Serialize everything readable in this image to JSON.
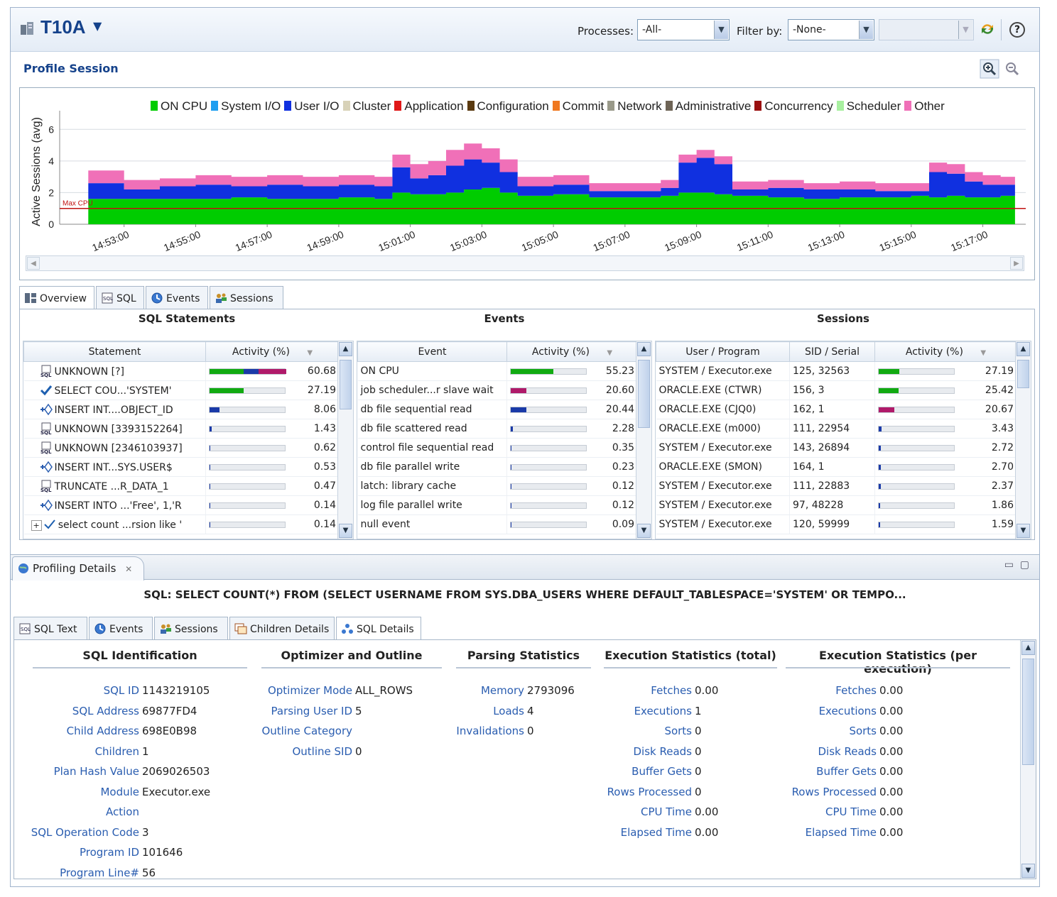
{
  "header": {
    "db_name": "T10A",
    "processes_label": "Processes:",
    "processes_value": "-All-",
    "filter_label": "Filter by:",
    "filter_value": "-None-",
    "help_label": "?"
  },
  "profile": {
    "title": "Profile Session"
  },
  "legend": [
    {
      "label": "ON CPU",
      "color": "#00cc00"
    },
    {
      "label": "System I/O",
      "color": "#1e9ef0"
    },
    {
      "label": "User I/O",
      "color": "#1030e0"
    },
    {
      "label": "Cluster",
      "color": "#d8d2b8"
    },
    {
      "label": "Application",
      "color": "#e01818"
    },
    {
      "label": "Configuration",
      "color": "#5a3a10"
    },
    {
      "label": "Commit",
      "color": "#f07820"
    },
    {
      "label": "Network",
      "color": "#9a9a8a"
    },
    {
      "label": "Administrative",
      "color": "#6e6456"
    },
    {
      "label": "Concurrency",
      "color": "#9a1010"
    },
    {
      "label": "Scheduler",
      "color": "#a8f0a0"
    },
    {
      "label": "Other",
      "color": "#f070b8"
    }
  ],
  "chart_data": {
    "type": "area",
    "ylabel": "Active Sessions (avg)",
    "yticks": [
      "0",
      "2",
      "4",
      "6"
    ],
    "ylim": [
      0,
      7
    ],
    "max_cpu_label": "Max CPU",
    "max_cpu_value": 1,
    "xticks": [
      "14:53:00",
      "14:55:00",
      "14:57:00",
      "14:59:00",
      "15:01:00",
      "15:03:00",
      "15:05:00",
      "15:07:00",
      "15:09:00",
      "15:11:00",
      "15:13:00",
      "15:15:00",
      "15:17:00"
    ],
    "x": [
      "14:52:00",
      "14:53:00",
      "14:54:00",
      "14:55:00",
      "14:56:00",
      "14:57:00",
      "14:58:00",
      "14:59:00",
      "15:00:00",
      "15:00:30",
      "15:01:00",
      "15:01:30",
      "15:02:00",
      "15:02:30",
      "15:03:00",
      "15:03:30",
      "15:04:00",
      "15:05:00",
      "15:06:00",
      "15:07:00",
      "15:08:00",
      "15:08:30",
      "15:09:00",
      "15:09:30",
      "15:10:00",
      "15:11:00",
      "15:12:00",
      "15:13:00",
      "15:14:00",
      "15:15:00",
      "15:15:30",
      "15:16:00",
      "15:16:30",
      "15:17:00",
      "15:17:30"
    ],
    "series": [
      {
        "name": "ON CPU",
        "color": "#00cc00",
        "values": [
          1.6,
          1.6,
          1.6,
          1.6,
          1.7,
          1.6,
          1.6,
          1.7,
          1.6,
          2.0,
          1.9,
          1.9,
          2.0,
          2.2,
          2.3,
          2.0,
          1.8,
          1.9,
          1.7,
          1.7,
          1.8,
          2.0,
          2.0,
          1.9,
          1.8,
          1.7,
          1.6,
          1.7,
          1.7,
          1.8,
          1.7,
          1.8,
          1.7,
          1.7,
          1.8
        ]
      },
      {
        "name": "User I/O",
        "color": "#1030e0",
        "values": [
          1.0,
          0.6,
          0.8,
          0.9,
          0.7,
          0.9,
          0.8,
          0.8,
          0.8,
          1.6,
          1.0,
          1.2,
          1.7,
          1.9,
          1.6,
          1.3,
          0.6,
          0.6,
          0.4,
          0.4,
          0.5,
          1.9,
          2.2,
          1.9,
          0.4,
          0.6,
          0.6,
          0.5,
          0.4,
          0.3,
          1.6,
          1.4,
          1.0,
          0.8,
          0.7
        ]
      },
      {
        "name": "Other",
        "color": "#f070b8",
        "values": [
          0.8,
          0.6,
          0.5,
          0.6,
          0.6,
          0.6,
          0.6,
          0.6,
          0.6,
          0.8,
          0.9,
          0.9,
          1.0,
          1.0,
          0.9,
          0.8,
          0.6,
          0.6,
          0.5,
          0.5,
          0.5,
          0.5,
          0.5,
          0.5,
          0.5,
          0.5,
          0.4,
          0.5,
          0.5,
          0.5,
          0.6,
          0.6,
          0.6,
          0.6,
          0.5
        ]
      }
    ]
  },
  "overview_tabs": [
    "Overview",
    "SQL",
    "Events",
    "Sessions"
  ],
  "sql_statements": {
    "title": "SQL Statements",
    "columns": [
      "Statement",
      "Activity (%)"
    ],
    "rows": [
      {
        "label": "UNKNOWN [?]",
        "value": "60.68",
        "pct": 60.68,
        "bars": [
          {
            "c": "#11aa11",
            "w": 0.44
          },
          {
            "c": "#1a3aa8",
            "w": 0.2
          },
          {
            "c": "#b01a6a",
            "w": 0.36
          }
        ]
      },
      {
        "label": "SELECT COU...'SYSTEM'",
        "value": "27.19",
        "pct": 27.19,
        "bars": [
          {
            "c": "#11aa11",
            "w": 1
          }
        ]
      },
      {
        "label": "INSERT INT....OBJECT_ID",
        "value": "8.06",
        "pct": 8.06,
        "bars": [
          {
            "c": "#1a3aa8",
            "w": 1
          }
        ]
      },
      {
        "label": "UNKNOWN [3393152264]",
        "value": "1.43",
        "pct": 1.43,
        "bars": [
          {
            "c": "#1a3aa8",
            "w": 1
          }
        ]
      },
      {
        "label": "UNKNOWN [2346103937]",
        "value": "0.62",
        "pct": 0.62,
        "bars": []
      },
      {
        "label": "INSERT INT...SYS.USER$",
        "value": "0.53",
        "pct": 0.53,
        "bars": []
      },
      {
        "label": "TRUNCATE ...R_DATA_1",
        "value": "0.47",
        "pct": 0.47,
        "bars": []
      },
      {
        "label": "INSERT INTO ...'Free', 1,'R",
        "value": "0.14",
        "pct": 0.14,
        "bars": []
      },
      {
        "label": "select count ...rsion like '",
        "value": "0.14",
        "pct": 0.14,
        "bars": []
      }
    ]
  },
  "events": {
    "title": "Events",
    "columns": [
      "Event",
      "Activity (%)"
    ],
    "rows": [
      {
        "label": "ON CPU",
        "value": "55.23",
        "pct": 55.23,
        "color": "#11aa11"
      },
      {
        "label": "job scheduler...r slave wait",
        "value": "20.60",
        "pct": 20.6,
        "color": "#b01a6a"
      },
      {
        "label": "db file sequential read",
        "value": "20.44",
        "pct": 20.44,
        "color": "#1a3aa8"
      },
      {
        "label": "db file scattered read",
        "value": "2.28",
        "pct": 2.28,
        "color": "#1a3aa8"
      },
      {
        "label": "control file sequential read",
        "value": "0.35",
        "pct": 0.35,
        "color": "#1a3aa8"
      },
      {
        "label": "db file parallel write",
        "value": "0.23",
        "pct": 0.23,
        "color": "#1a3aa8"
      },
      {
        "label": "latch: library cache",
        "value": "0.12",
        "pct": 0.12,
        "color": "#1a3aa8"
      },
      {
        "label": "log file parallel write",
        "value": "0.12",
        "pct": 0.12,
        "color": "#1a3aa8"
      },
      {
        "label": "null event",
        "value": "0.09",
        "pct": 0.09,
        "color": "#1a3aa8"
      }
    ]
  },
  "sessions": {
    "title": "Sessions",
    "columns": [
      "User / Program",
      "SID / Serial",
      "Activity (%)"
    ],
    "rows": [
      {
        "user": "SYSTEM / Executor.exe",
        "sid": "125, 32563",
        "value": "27.19",
        "pct": 27.19,
        "color": "#11aa11"
      },
      {
        "user": "ORACLE.EXE (CTWR)",
        "sid": "156, 3",
        "value": "25.42",
        "pct": 25.42,
        "color": "#11aa11"
      },
      {
        "user": "ORACLE.EXE (CJQ0)",
        "sid": "162, 1",
        "value": "20.67",
        "pct": 20.67,
        "color": "#b01a6a"
      },
      {
        "user": "ORACLE.EXE (m000)",
        "sid": "111, 22954",
        "value": "3.43",
        "pct": 3.43,
        "color": "#1a3aa8"
      },
      {
        "user": "SYSTEM / Executor.exe",
        "sid": "143, 26894",
        "value": "2.72",
        "pct": 2.72,
        "color": "#1a3aa8"
      },
      {
        "user": "ORACLE.EXE (SMON)",
        "sid": "164, 1",
        "value": "2.70",
        "pct": 2.7,
        "color": "#1a3aa8"
      },
      {
        "user": "SYSTEM / Executor.exe",
        "sid": "111, 22883",
        "value": "2.37",
        "pct": 2.37,
        "color": "#1a3aa8"
      },
      {
        "user": "SYSTEM / Executor.exe",
        "sid": "97, 48228",
        "value": "1.86",
        "pct": 1.86,
        "color": "#1a3aa8"
      },
      {
        "user": "SYSTEM / Executor.exe",
        "sid": "120, 59999",
        "value": "1.59",
        "pct": 1.59,
        "color": "#1a3aa8"
      }
    ]
  },
  "profiling": {
    "tab_label": "Profiling Details",
    "sql_title": "SQL: SELECT COUNT(*) FROM (SELECT USERNAME FROM SYS.DBA_USERS WHERE DEFAULT_TABLESPACE='SYSTEM' OR TEMPO...",
    "tabs": [
      "SQL Text",
      "Events",
      "Sessions",
      "Children Details",
      "SQL Details"
    ],
    "sections": {
      "sql_identification": {
        "title": "SQL Identification",
        "items": [
          {
            "k": "SQL ID",
            "v": "1143219105"
          },
          {
            "k": "SQL Address",
            "v": "69877FD4"
          },
          {
            "k": "Child Address",
            "v": "698E0B98"
          },
          {
            "k": "Children",
            "v": "1"
          },
          {
            "k": "Plan Hash Value",
            "v": "2069026503"
          },
          {
            "k": "Module",
            "v": "Executor.exe"
          },
          {
            "k": "Action",
            "v": ""
          },
          {
            "k": "SQL Operation Code",
            "v": "3"
          },
          {
            "k": "Program ID",
            "v": "101646"
          },
          {
            "k": "Program Line#",
            "v": "56"
          }
        ]
      },
      "optimizer": {
        "title": "Optimizer and Outline",
        "items": [
          {
            "k": "Optimizer Mode",
            "v": "ALL_ROWS"
          },
          {
            "k": "Parsing User ID",
            "v": "5"
          },
          {
            "k": "Outline Category",
            "v": ""
          },
          {
            "k": "Outline SID",
            "v": "0"
          }
        ]
      },
      "parsing": {
        "title": "Parsing Statistics",
        "items": [
          {
            "k": "Memory",
            "v": "2793096"
          },
          {
            "k": "Loads",
            "v": "4"
          },
          {
            "k": "Invalidations",
            "v": "0"
          }
        ]
      },
      "exec_total": {
        "title": "Execution Statistics (total)",
        "items": [
          {
            "k": "Fetches",
            "v": "0.00"
          },
          {
            "k": "Executions",
            "v": "1"
          },
          {
            "k": "Sorts",
            "v": "0"
          },
          {
            "k": "Disk Reads",
            "v": "0"
          },
          {
            "k": "Buffer Gets",
            "v": "0"
          },
          {
            "k": "Rows Processed",
            "v": "0"
          },
          {
            "k": "CPU Time",
            "v": "0.00"
          },
          {
            "k": "Elapsed Time",
            "v": "0.00"
          }
        ]
      },
      "exec_per": {
        "title": "Execution Statistics (per execution)",
        "items": [
          {
            "k": "Fetches",
            "v": "0.00"
          },
          {
            "k": "Executions",
            "v": "0.00"
          },
          {
            "k": "Sorts",
            "v": "0.00"
          },
          {
            "k": "Disk Reads",
            "v": "0.00"
          },
          {
            "k": "Buffer Gets",
            "v": "0.00"
          },
          {
            "k": "Rows Processed",
            "v": "0.00"
          },
          {
            "k": "CPU Time",
            "v": "0.00"
          },
          {
            "k": "Elapsed Time",
            "v": "0.00"
          }
        ]
      }
    }
  }
}
